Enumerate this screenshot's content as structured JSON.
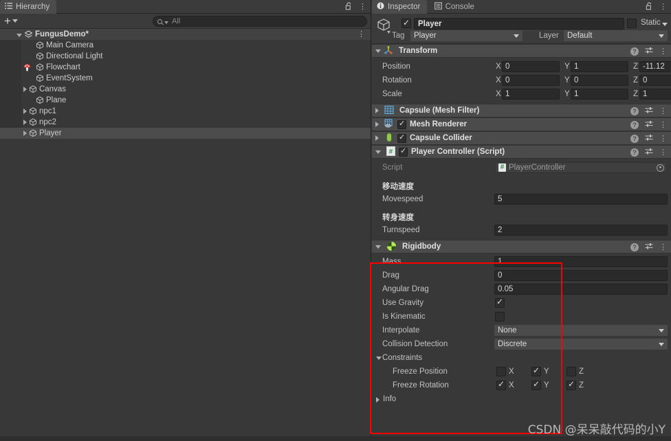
{
  "hierarchy": {
    "tab_label": "Hierarchy",
    "tab_icon": "hierarchy-icon",
    "lock_icon": "lock-open-icon",
    "menu_icon": "kebab-menu-icon",
    "create_label": "+",
    "search": {
      "value": "",
      "placeholder": "All",
      "icon": "search-icon"
    },
    "scene": {
      "name": "FungusDemo*",
      "expanded": true
    },
    "items": [
      {
        "label": "Main Camera",
        "indent": 2,
        "fold": "none",
        "badge": ""
      },
      {
        "label": "Directional Light",
        "indent": 2,
        "fold": "none",
        "badge": ""
      },
      {
        "label": "Flowchart",
        "indent": 2,
        "fold": "none",
        "badge": "fungus-mushroom-icon"
      },
      {
        "label": "EventSystem",
        "indent": 2,
        "fold": "none",
        "badge": ""
      },
      {
        "label": "Canvas",
        "indent": 1,
        "fold": "closed",
        "badge": ""
      },
      {
        "label": "Plane",
        "indent": 2,
        "fold": "none",
        "badge": ""
      },
      {
        "label": "npc1",
        "indent": 1,
        "fold": "closed",
        "badge": ""
      },
      {
        "label": "npc2",
        "indent": 1,
        "fold": "closed",
        "badge": ""
      },
      {
        "label": "Player",
        "indent": 1,
        "fold": "closed",
        "badge": "",
        "selected": true
      }
    ]
  },
  "inspector": {
    "tabs": [
      {
        "label": "Inspector",
        "icon": "info-circle-icon",
        "active": true
      },
      {
        "label": "Console",
        "icon": "console-icon",
        "active": false
      }
    ],
    "lock_icon": "lock-open-icon",
    "menu_icon": "kebab-menu-icon",
    "header": {
      "object_icon": "gameobject-cube-icon",
      "enabled": true,
      "name": "Player",
      "static_label": "Static",
      "static_checked": false,
      "tag_label": "Tag",
      "tag_value": "Player",
      "layer_label": "Layer",
      "layer_value": "Default"
    },
    "transform": {
      "title": "Transform",
      "icon": "transform-axes-icon",
      "expanded": true,
      "rows": [
        {
          "label": "Position",
          "x": "0",
          "y": "1",
          "z": "-11.12"
        },
        {
          "label": "Rotation",
          "x": "0",
          "y": "0",
          "z": "0"
        },
        {
          "label": "Scale",
          "x": "1",
          "y": "1",
          "z": "1"
        }
      ],
      "axis_labels": [
        "X",
        "Y",
        "Z"
      ]
    },
    "components": [
      {
        "title": "Capsule (Mesh Filter)",
        "icon": "mesh-filter-icon",
        "expanded": false,
        "has_toggle": false,
        "enabled": false
      },
      {
        "title": "Mesh Renderer",
        "icon": "mesh-renderer-icon",
        "expanded": false,
        "has_toggle": true,
        "enabled": true
      },
      {
        "title": "Capsule Collider",
        "icon": "capsule-collider-icon",
        "expanded": false,
        "has_toggle": true,
        "enabled": true
      }
    ],
    "player_controller": {
      "title": "Player Controller (Script)",
      "icon": "csharp-script-icon",
      "expanded": true,
      "has_toggle": true,
      "enabled": true,
      "script_label": "Script",
      "script_value": "PlayerController",
      "script_value_icon": "csharp-script-icon",
      "picker_icon": "object-picker-icon",
      "fields": [
        {
          "header": "移动速度",
          "label": "Movespeed",
          "value": "5"
        },
        {
          "header": "转身速度",
          "label": "Turnspeed",
          "value": "2"
        }
      ]
    },
    "rigidbody": {
      "title": "Rigidbody",
      "icon": "rigidbody-icon",
      "expanded": true,
      "rows": [
        {
          "label": "Mass",
          "type": "number",
          "value": "1"
        },
        {
          "label": "Drag",
          "type": "number",
          "value": "0"
        },
        {
          "label": "Angular Drag",
          "type": "number",
          "value": "0.05"
        },
        {
          "label": "Use Gravity",
          "type": "bool",
          "checked": true
        },
        {
          "label": "Is Kinematic",
          "type": "bool",
          "checked": false
        },
        {
          "label": "Interpolate",
          "type": "enum",
          "value": "None"
        },
        {
          "label": "Collision Detection",
          "type": "enum",
          "value": "Discrete"
        }
      ],
      "constraints": {
        "label": "Constraints",
        "expanded": true,
        "freeze_position": {
          "label": "Freeze Position",
          "axes": [
            "X",
            "Y",
            "Z"
          ],
          "checked": [
            false,
            true,
            false
          ]
        },
        "freeze_rotation": {
          "label": "Freeze Rotation",
          "axes": [
            "X",
            "Y",
            "Z"
          ],
          "checked": [
            true,
            true,
            true
          ]
        }
      },
      "info": {
        "label": "Info",
        "expanded": false
      }
    }
  },
  "annotation": {
    "highlight_color": "#ff0000"
  },
  "watermark": {
    "text": "CSDN @呆呆敲代码的小Y"
  }
}
